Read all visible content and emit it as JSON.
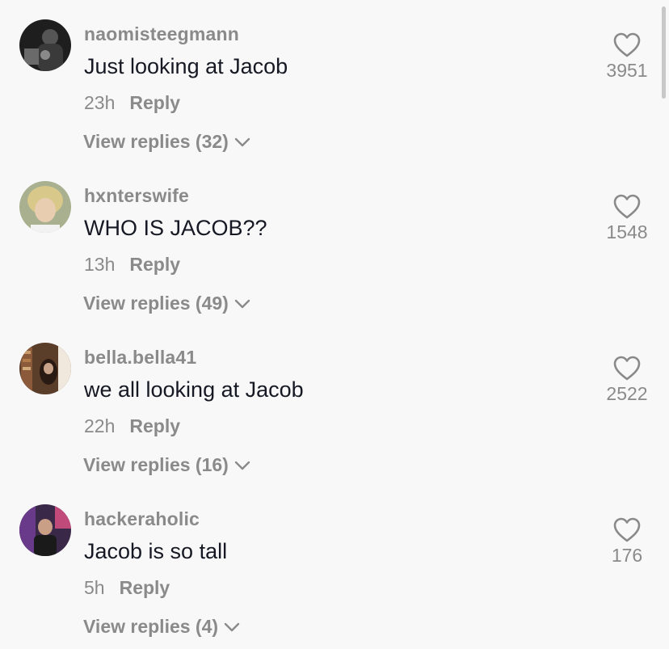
{
  "comments": [
    {
      "username": "naomisteegmann",
      "text": "Just looking at Jacob",
      "time": "23h",
      "reply_label": "Reply",
      "view_replies": "View replies (32)",
      "likes": "3951",
      "avatar_color": "#2b2b2b"
    },
    {
      "username": "hxnterswife",
      "text": "WHO IS JACOB??",
      "time": "13h",
      "reply_label": "Reply",
      "view_replies": "View replies (49)",
      "likes": "1548",
      "avatar_color": "#c9c39a"
    },
    {
      "username": "bella.bella41",
      "text": "we all looking at Jacob",
      "time": "22h",
      "reply_label": "Reply",
      "view_replies": "View replies (16)",
      "likes": "2522",
      "avatar_color": "#8a6a4a"
    },
    {
      "username": "hackeraholic",
      "text": "Jacob is so tall",
      "time": "5h",
      "reply_label": "Reply",
      "view_replies": "View replies (4)",
      "likes": "176",
      "avatar_color": "#5a3a6a"
    }
  ],
  "colors": {
    "background": "#f8f8f8",
    "primary_text": "#161823",
    "secondary_text": "#8a8a8a"
  },
  "icons": {
    "like": "heart-outline-icon",
    "expand": "chevron-down-icon"
  }
}
